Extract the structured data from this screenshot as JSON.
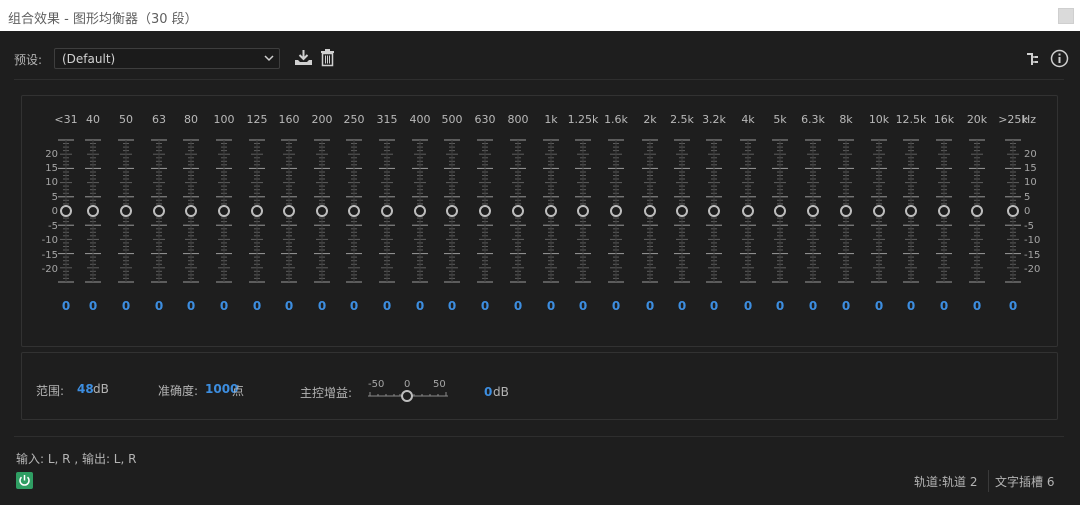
{
  "window": {
    "title": "组合效果 - 图形均衡器（30 段）"
  },
  "preset": {
    "label": "预设:",
    "value": "(Default)"
  },
  "toolbar": {
    "save_icon": "download-save-icon",
    "delete_icon": "trash-icon",
    "routing_icon": "routing-icon",
    "info_icon": "info-icon"
  },
  "bands": [
    {
      "label": "<31",
      "value": "0"
    },
    {
      "label": "40",
      "value": "0"
    },
    {
      "label": "50",
      "value": "0"
    },
    {
      "label": "63",
      "value": "0"
    },
    {
      "label": "80",
      "value": "0"
    },
    {
      "label": "100",
      "value": "0"
    },
    {
      "label": "125",
      "value": "0"
    },
    {
      "label": "160",
      "value": "0"
    },
    {
      "label": "200",
      "value": "0"
    },
    {
      "label": "250",
      "value": "0"
    },
    {
      "label": "315",
      "value": "0"
    },
    {
      "label": "400",
      "value": "0"
    },
    {
      "label": "500",
      "value": "0"
    },
    {
      "label": "630",
      "value": "0"
    },
    {
      "label": "800",
      "value": "0"
    },
    {
      "label": "1k",
      "value": "0"
    },
    {
      "label": "1.25k",
      "value": "0"
    },
    {
      "label": "1.6k",
      "value": "0"
    },
    {
      "label": "2k",
      "value": "0"
    },
    {
      "label": "2.5k",
      "value": "0"
    },
    {
      "label": "3.2k",
      "value": "0"
    },
    {
      "label": "4k",
      "value": "0"
    },
    {
      "label": "5k",
      "value": "0"
    },
    {
      "label": "6.3k",
      "value": "0"
    },
    {
      "label": "8k",
      "value": "0"
    },
    {
      "label": "10k",
      "value": "0"
    },
    {
      "label": "12.5k",
      "value": "0"
    },
    {
      "label": "16k",
      "value": "0"
    },
    {
      "label": "20k",
      "value": "0"
    },
    {
      "label": ">25k",
      "value": "0"
    }
  ],
  "hz_unit": "Hz",
  "scale": [
    "20",
    "15",
    "10",
    "5",
    "0",
    "-5",
    "-10",
    "-15",
    "-20"
  ],
  "range": {
    "label": "范围:",
    "value": "48",
    "unit": "dB"
  },
  "accuracy": {
    "label": "准确度:",
    "value": "1000",
    "unit": "点"
  },
  "master_gain": {
    "label": "主控增益:",
    "scale_min": "-50",
    "scale_mid": "0",
    "scale_max": "50",
    "value": "0",
    "unit": "dB",
    "level": 0
  },
  "io": {
    "text": "输入: L, R , 输出: L, R"
  },
  "status": {
    "track": "轨道:轨道 2",
    "slot": "文字插槽 6"
  },
  "colors": {
    "accent": "#3d8ee0",
    "power": "#2f9e63",
    "background": "#1e1e1e"
  }
}
